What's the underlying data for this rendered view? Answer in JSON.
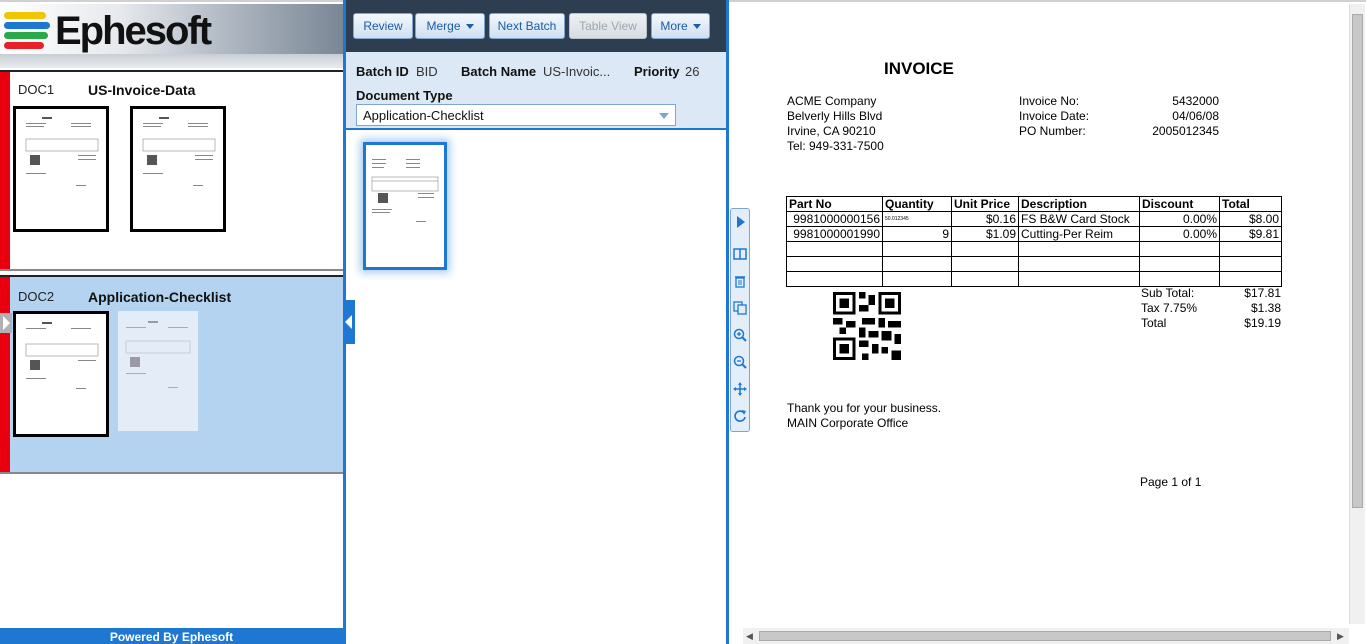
{
  "brand": {
    "logo_text": "Ephesoft",
    "footer": "Powered By Ephesoft",
    "stripe_colors": [
      "#f2c500",
      "#1e78d2",
      "#2aa84a",
      "#e8202a"
    ]
  },
  "documents": [
    {
      "id": "DOC1",
      "type": "US-Invoice-Data",
      "pages": 2
    },
    {
      "id": "DOC2",
      "type": "Application-Checklist",
      "pages": 2,
      "selected": true
    }
  ],
  "toolbar": {
    "review": "Review",
    "merge": "Merge",
    "next_batch": "Next Batch",
    "table_view": "Table View",
    "more": "More"
  },
  "batch": {
    "id_label": "Batch ID",
    "id_value": "BID",
    "name_label": "Batch Name",
    "name_value": "US-Invoic...",
    "priority_label": "Priority",
    "priority_value": "26",
    "doctype_label": "Document Type",
    "doctype_value": "Application-Checklist"
  },
  "invoice": {
    "title": "INVOICE",
    "company": [
      "ACME Company",
      "Belverly Hills Blvd",
      "Irvine, CA 90210",
      "Tel: 949-331-7500"
    ],
    "meta_labels": [
      "Invoice No:",
      "Invoice Date:",
      "PO Number:"
    ],
    "meta_values": [
      "5432000",
      "04/06/08",
      "2005012345"
    ],
    "table_headers": [
      "Part No",
      "Quantity",
      "Unit Price",
      "Description",
      "Discount",
      "Total"
    ],
    "rows": [
      [
        "9981000000156",
        "50.012345",
        "$0.16",
        "FS B&W Card Stock",
        "0.00%",
        "$8.00"
      ],
      [
        "9981000001990",
        "9",
        "$1.09",
        "Cutting-Per Reim",
        "0.00%",
        "$9.81"
      ]
    ],
    "summary_labels": [
      "Sub Total:",
      "Tax 7.75%",
      "Total"
    ],
    "summary_values": [
      "$17.81",
      "$1.38",
      "$19.19"
    ],
    "thanks": "Thank you for your business.",
    "office": "MAIN Corporate Office",
    "page": "Page 1 of 1"
  },
  "viewer_tools": [
    "play-icon",
    "columns-icon",
    "trash-icon",
    "copy-icon",
    "zoom-in-icon",
    "zoom-out-icon",
    "move-icon",
    "rotate-icon"
  ]
}
